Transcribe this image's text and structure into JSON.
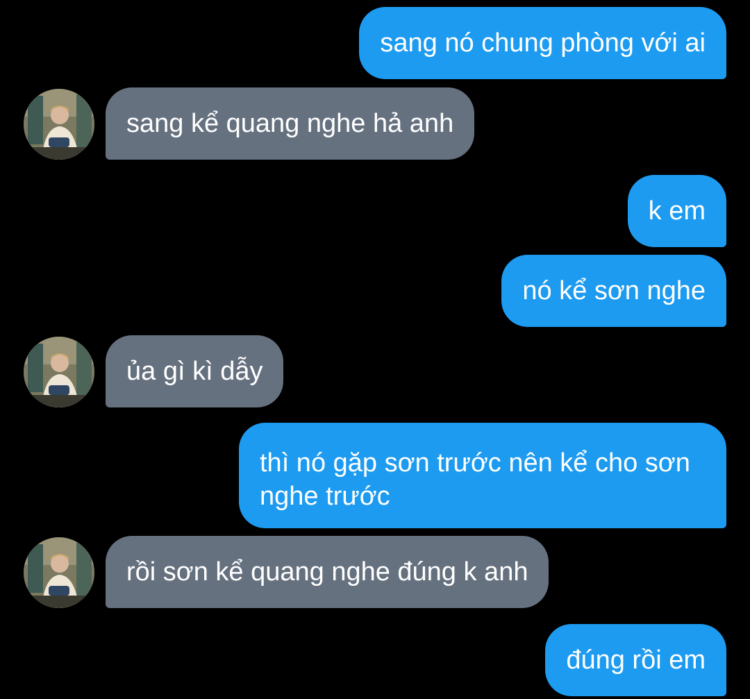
{
  "conversation": {
    "messages": [
      {
        "side": "out",
        "text": "sang nó chung phòng với ai"
      },
      {
        "side": "in",
        "text": "sang kể quang nghe hả anh"
      },
      {
        "side": "out",
        "text": "k em"
      },
      {
        "side": "out",
        "text": "nó kể sơn nghe"
      },
      {
        "side": "in",
        "text": "ủa gì kì dẫy"
      },
      {
        "side": "out",
        "text": "thì nó gặp sơn trước nên kể cho sơn nghe trước"
      },
      {
        "side": "in",
        "text": "rồi sơn kể quang nghe đúng k anh"
      },
      {
        "side": "out",
        "text": "đúng rồi em"
      }
    ]
  },
  "avatar": {
    "icon": "contact-avatar-photo"
  },
  "colors": {
    "background": "#000000",
    "outgoing_bubble": "#1d9bf0",
    "incoming_bubble": "#66717f",
    "text": "#ffffff"
  }
}
